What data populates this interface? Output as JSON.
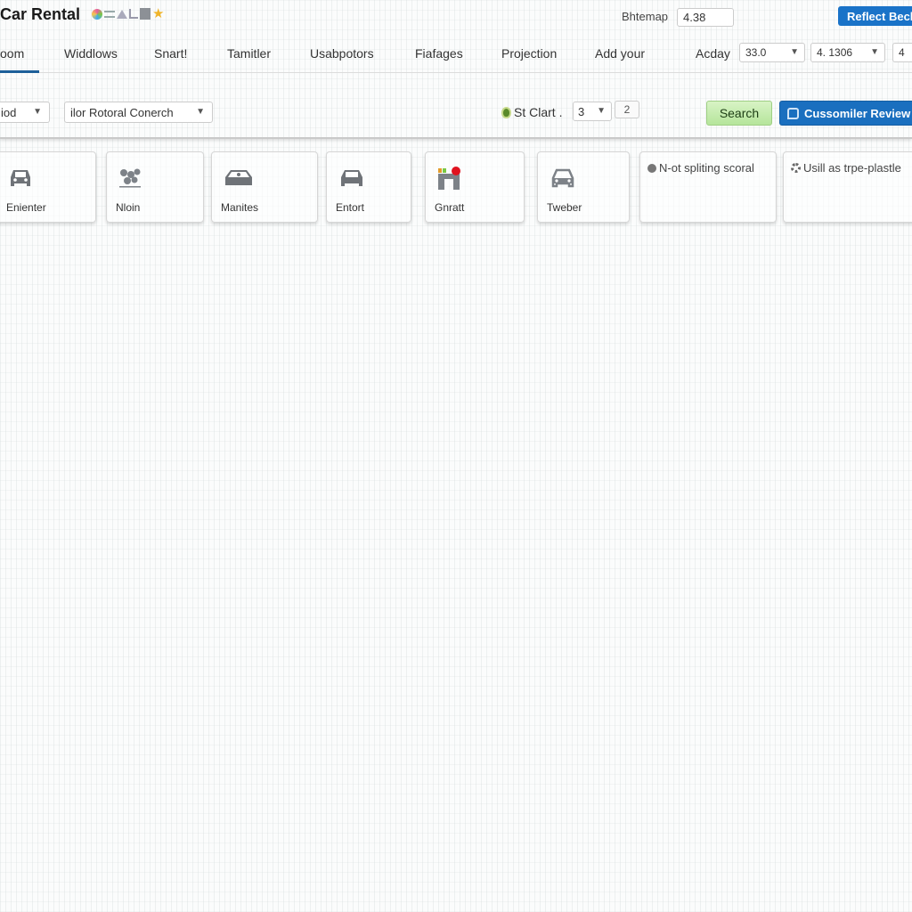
{
  "header": {
    "app_title": "Car Rental",
    "title_icons": [
      "swirl-logo-icon",
      "equals-icon",
      "triangle-icon",
      "corner-icon",
      "square-icon",
      "star-icon"
    ],
    "star_color": "#f0b429",
    "bitmap_label": "Bhtemap",
    "bitmap_value": "4.38",
    "reflect_button": "Reflect Bech",
    "accent_color": "#1a73c8"
  },
  "nav": {
    "tabs": [
      {
        "label": "oom",
        "active": true
      },
      {
        "label": "Widdlows"
      },
      {
        "label": "Snart!"
      },
      {
        "label": "Tamitler"
      },
      {
        "label": "Usabpotors"
      },
      {
        "label": "Fiafages"
      },
      {
        "label": "Projection"
      },
      {
        "label": "Add your"
      }
    ],
    "acday_label": "Acday",
    "select_1": "33.0",
    "select_2": "4. 1306",
    "select_3": "4",
    "active_underline_color": "#1d5f99"
  },
  "filters": {
    "select_1": "iod",
    "select_2": "ilor Rotoral Conerch",
    "stclart_label": "St Clart .",
    "page_select": "3",
    "page_number": "2",
    "search_button": "Search",
    "review_button": "Cussomiler Review",
    "search_color": "#b5e59b",
    "review_color": "#1a6fbf"
  },
  "cards": [
    {
      "label": "Enienter",
      "icon": "car-front-icon"
    },
    {
      "label": "Nloin",
      "icon": "plant-icon"
    },
    {
      "label": "Manites",
      "icon": "car-wrench-icon"
    },
    {
      "label": "Entort",
      "icon": "car-icon"
    },
    {
      "label": "Gnratt",
      "icon": "building-icon"
    },
    {
      "label": "Tweber",
      "icon": "car-outline-icon"
    },
    {
      "label": "N-ot spliting scoral",
      "icon": "dot-icon"
    },
    {
      "label": "Usill as trpe-plastle",
      "icon": "gear-icon"
    }
  ]
}
